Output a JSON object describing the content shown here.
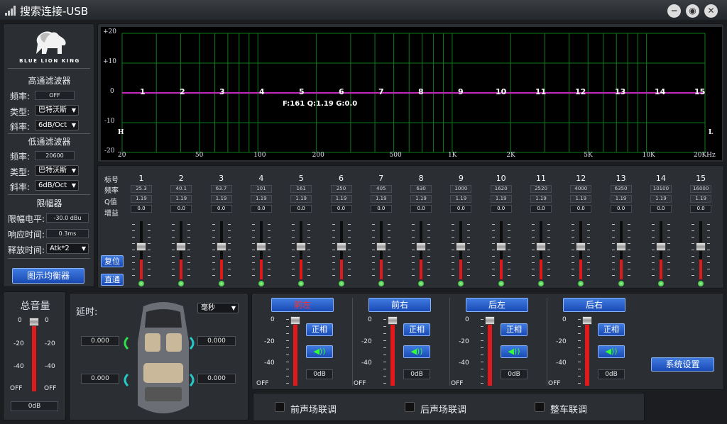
{
  "window": {
    "title": "搜索连接-USB",
    "minimize": "−",
    "restore": "◉",
    "close": "✕"
  },
  "brand": {
    "logo_text": "BLUE LION KING"
  },
  "highpass": {
    "title": "高通滤波器",
    "freq_label": "频率:",
    "freq_value": "OFF",
    "type_label": "类型:",
    "type_value": "巴特沃斯",
    "slope_label": "斜率:",
    "slope_value": "6dB/Oct"
  },
  "lowpass": {
    "title": "低通滤波器",
    "freq_label": "频率:",
    "freq_value": "20600",
    "type_label": "类型:",
    "type_value": "巴特沃斯",
    "slope_label": "斜率:",
    "slope_value": "6dB/Oct"
  },
  "limiter": {
    "title": "限幅器",
    "level_label": "限幅电平:",
    "level_value": "-30.0 dBu",
    "attack_label": "响应时间:",
    "attack_value": "0.3ms",
    "release_label": "释放时间:",
    "release_value": "Atk*2"
  },
  "graph_button": "图示均衡器",
  "graph": {
    "y_ticks": [
      "+20",
      "+10",
      "0",
      "-10",
      "-20"
    ],
    "x_ticks": [
      "20",
      "50",
      "100",
      "200",
      "500",
      "1K",
      "2K",
      "5K",
      "10K",
      "20KHz"
    ],
    "hp_marker": "H",
    "lp_marker": "L",
    "info": "F:161 Q:1.19 G:0.0",
    "bands": [
      "1",
      "2",
      "3",
      "4",
      "5",
      "6",
      "7",
      "8",
      "9",
      "10",
      "11",
      "12",
      "13",
      "14",
      "15"
    ]
  },
  "eq": {
    "row_labels": [
      "标号",
      "频率",
      "Q值",
      "增益"
    ],
    "bands": [
      {
        "n": "1",
        "f": "25.3",
        "q": "1.19",
        "g": "0.0"
      },
      {
        "n": "2",
        "f": "40.1",
        "q": "1.19",
        "g": "0.0"
      },
      {
        "n": "3",
        "f": "63.7",
        "q": "1.19",
        "g": "0.0"
      },
      {
        "n": "4",
        "f": "101",
        "q": "1.19",
        "g": "0.0"
      },
      {
        "n": "5",
        "f": "161",
        "q": "1.19",
        "g": "0.0"
      },
      {
        "n": "6",
        "f": "250",
        "q": "1.19",
        "g": "0.0"
      },
      {
        "n": "7",
        "f": "405",
        "q": "1.19",
        "g": "0.0"
      },
      {
        "n": "8",
        "f": "630",
        "q": "1.19",
        "g": "0.0"
      },
      {
        "n": "9",
        "f": "1000",
        "q": "1.19",
        "g": "0.0"
      },
      {
        "n": "10",
        "f": "1620",
        "q": "1.19",
        "g": "0.0"
      },
      {
        "n": "11",
        "f": "2520",
        "q": "1.19",
        "g": "0.0"
      },
      {
        "n": "12",
        "f": "4000",
        "q": "1.19",
        "g": "0.0"
      },
      {
        "n": "13",
        "f": "6350",
        "q": "1.19",
        "g": "0.0"
      },
      {
        "n": "14",
        "f": "10100",
        "q": "1.19",
        "g": "0.0"
      },
      {
        "n": "15",
        "f": "16000",
        "q": "1.19",
        "g": "0.0"
      }
    ],
    "reset_button": "复位",
    "bypass_button": "直通"
  },
  "master": {
    "title": "总音量",
    "scale": [
      "0",
      "-20",
      "-40",
      "OFF"
    ],
    "value": "0dB"
  },
  "delay": {
    "title": "延时:",
    "unit": "毫秒",
    "fl": "0.000",
    "fr": "0.000",
    "rl": "0.000",
    "rr": "0.000"
  },
  "channels": [
    {
      "name": "前左",
      "phase": "正相",
      "value": "0dB",
      "active": true
    },
    {
      "name": "前右",
      "phase": "正相",
      "value": "0dB",
      "active": false
    },
    {
      "name": "后左",
      "phase": "正相",
      "value": "0dB",
      "active": false
    },
    {
      "name": "后右",
      "phase": "正相",
      "value": "0dB",
      "active": false
    }
  ],
  "channel_scale": [
    "0",
    "-20",
    "-40",
    "OFF"
  ],
  "settings_button": "系统设置",
  "links": {
    "front": "前声场联调",
    "rear": "后声场联调",
    "all": "整车联调"
  }
}
